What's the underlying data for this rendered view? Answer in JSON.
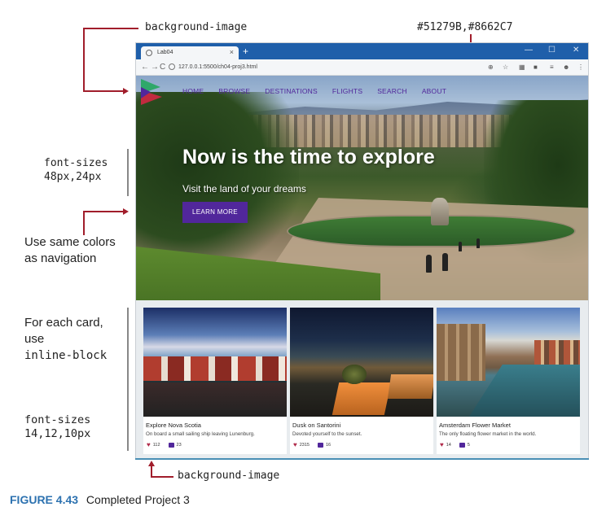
{
  "annotations": {
    "bg_image_top": "background-image",
    "colors": "#51279B,#8662C7",
    "font_sizes_hero_1": "font-sizes",
    "font_sizes_hero_2": "48px,24px",
    "same_colors_1": "Use same colors",
    "same_colors_2": "as navigation",
    "card_1": "For each card,",
    "card_2": "use",
    "card_3": "inline-block",
    "font_sizes_cards_1": "font-sizes",
    "font_sizes_cards_2": "14,12,10px",
    "bg_image_bottom": "background-image"
  },
  "browser": {
    "tab_title": "Lab04",
    "tab_close": "×",
    "new_tab": "+",
    "win_min": "—",
    "win_max": "☐",
    "win_close": "✕",
    "url": "127.0.0.1:5500/ch04-proj3.html"
  },
  "nav": {
    "items": [
      "HOME",
      "BROWSE",
      "DESTINATIONS",
      "FLIGHTS",
      "SEARCH",
      "ABOUT"
    ]
  },
  "hero": {
    "title": "Now is the time to explore",
    "subtitle": "Visit the land of your dreams",
    "button": "LEARN MORE"
  },
  "cards": [
    {
      "title": "Explore Nova Scotia",
      "desc": "On board a small sailing ship leaving Lunenburg.",
      "likes": "112",
      "comments": "23"
    },
    {
      "title": "Dusk on Santorini",
      "desc": "Devoted yourself to the sunset.",
      "likes": "2315",
      "comments": "16"
    },
    {
      "title": "Amsterdam Flower Market",
      "desc": "The only floating flower market in the world.",
      "likes": "14",
      "comments": "5"
    }
  ],
  "caption": {
    "figure": "FIGURE 4.43",
    "text": "Completed Project 3"
  },
  "colors": {
    "primary": "#51279B",
    "secondary": "#8662C7",
    "annotation_line": "#a11d2b",
    "titlebar": "#1f5faa"
  }
}
